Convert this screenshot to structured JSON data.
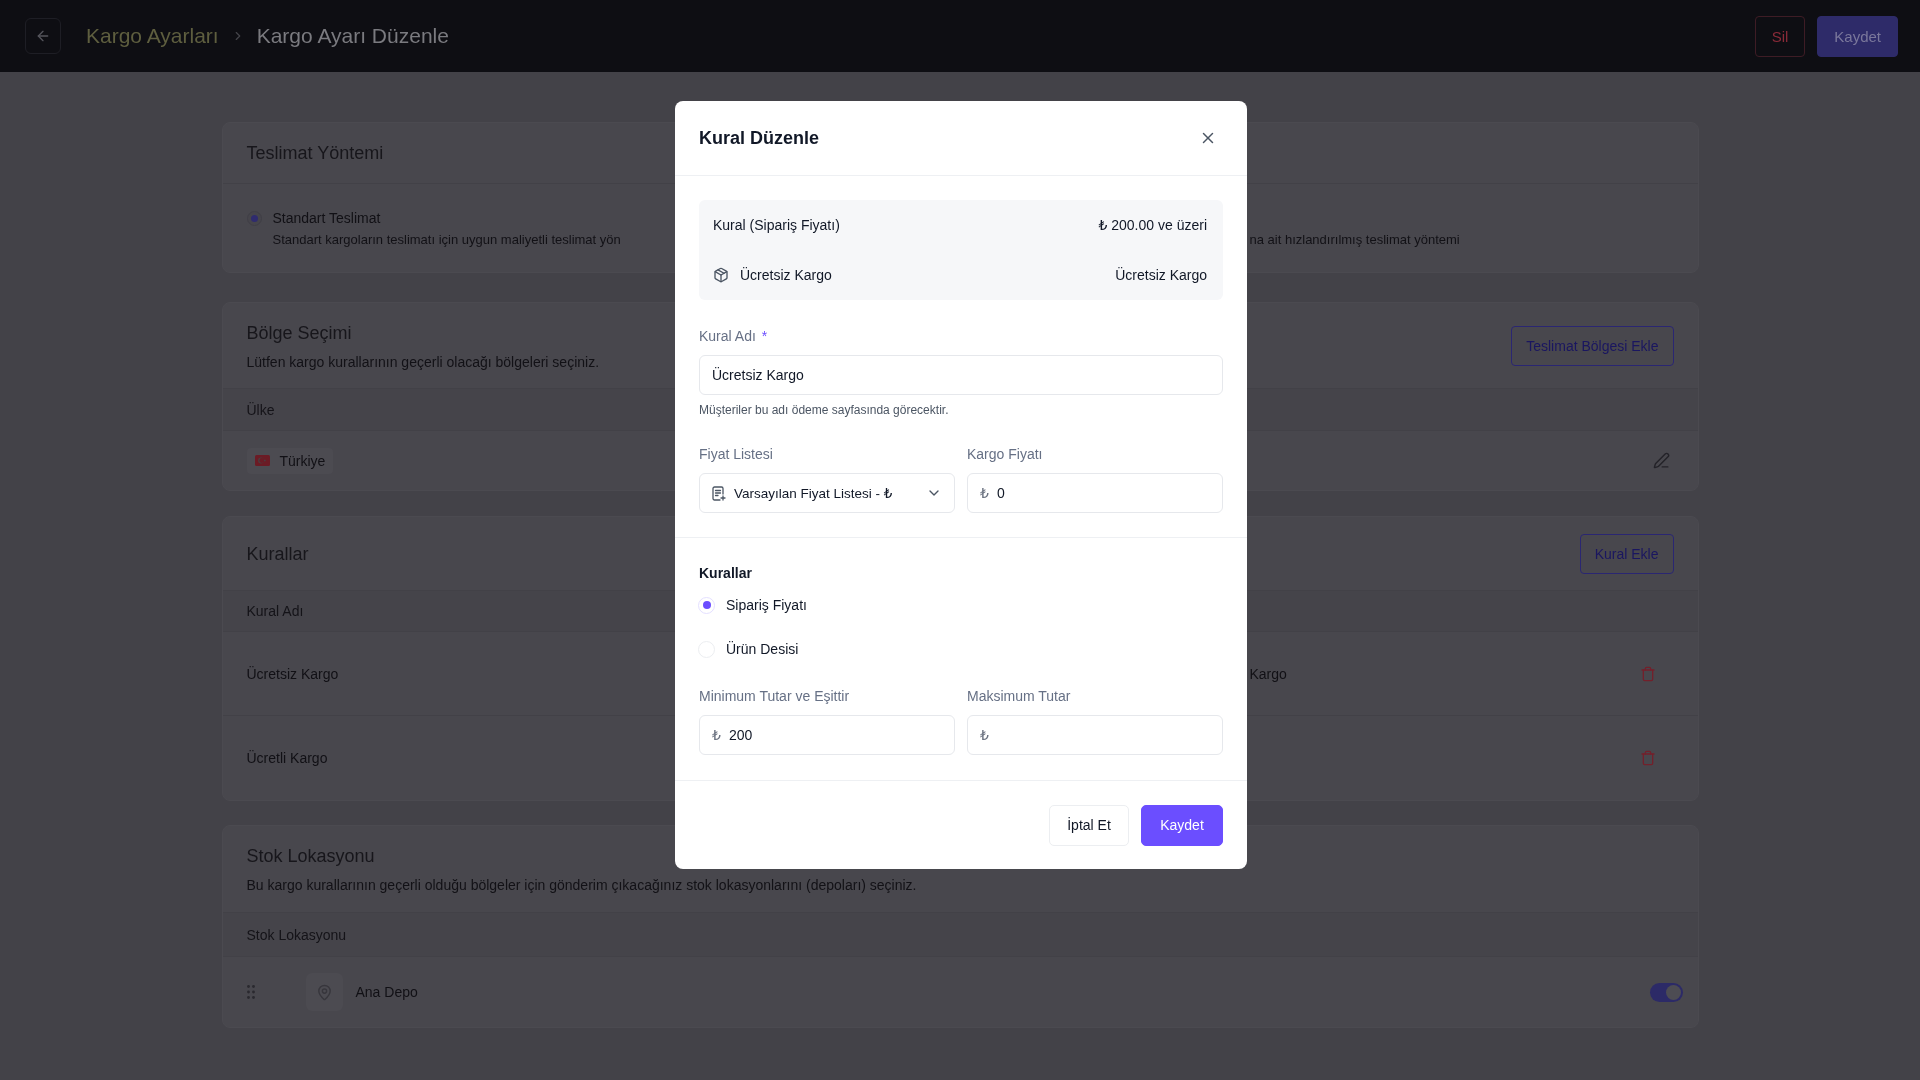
{
  "top_bar": {
    "breadcrumb": [
      {
        "label": "Kargo Ayarları",
        "kind": "link"
      },
      {
        "label": "Kargo Ayarı Düzenle",
        "kind": "current"
      }
    ],
    "buttons": [
      {
        "label": "Sil",
        "kind": "danger"
      },
      {
        "label": "Kaydet",
        "kind": "primary"
      }
    ]
  },
  "delivery_method": {
    "title": "Teslimat Yöntemi",
    "options": [
      {
        "title": "Standart Teslimat",
        "description": "Standart kargoların teslimatı için uygun maliyetli teslimat yön",
        "selected": true
      }
    ],
    "partial_text": "na ait hızlandırılmış teslimat yöntemi"
  },
  "region": {
    "title": "Bölge Seçimi",
    "subtitle": "Lütfen kargo kurallarının geçerli olacağı bölgeleri seçiniz.",
    "button": "Teslimat Bölgesi Ekle",
    "columns": [
      "Ülke"
    ],
    "rows": [
      {
        "country": "Türkiye"
      }
    ]
  },
  "rules": {
    "title": "Kurallar",
    "button": "Kural Ekle",
    "columns": [
      "Kural Adı"
    ],
    "rows": [
      {
        "name": "Ücretsiz Kargo",
        "column_2": "Kargo"
      },
      {
        "name": "Ücretli Kargo"
      }
    ]
  },
  "stock": {
    "title": "Stok Lokasyonu",
    "subtitle": "Bu kargo kurallarının geçerli olduğu bölgeler için gönderim çıkacağınız stok lokasyonlarını (depoları) seçiniz.",
    "columns": [
      "Stok Lokasyonu"
    ],
    "rows": [
      {
        "name": "Ana Depo",
        "on": true
      }
    ]
  },
  "modal": {
    "title": "Kural Düzenle",
    "summary": [
      {
        "kind": "rule",
        "label": "Kural (Sipariş Fiyatı)",
        "value": "₺ 200.00 ve üzeri"
      },
      {
        "kind": "shipping",
        "label": "Ücretsiz Kargo",
        "value": "Ücretsiz Kargo"
      }
    ],
    "name_field": {
      "label": "Kural Adı",
      "required_mark": "*",
      "value": "Ücretsiz Kargo",
      "help": "Müşteriler bu adı ödeme sayfasında görecektir."
    },
    "price_list": {
      "label": "Fiyat Listesi",
      "value": "Varsayılan Fiyat Listesi - ₺"
    },
    "shipping_price": {
      "label": "Kargo Fiyatı",
      "prefix": "₺",
      "value": "0"
    },
    "rule_type": {
      "title": "Kurallar",
      "options": [
        {
          "label": "Sipariş Fiyatı",
          "selected": true
        },
        {
          "label": "Ürün Desisi",
          "selected": false
        }
      ]
    },
    "min_amount": {
      "label": "Minimum Tutar ve Eşittir",
      "prefix": "₺",
      "value": "200"
    },
    "max_amount": {
      "label": "Maksimum Tutar",
      "prefix": "₺"
    },
    "buttons": [
      {
        "label": "İptal Et",
        "kind": "secondary"
      },
      {
        "label": "Kaydet",
        "kind": "primary"
      }
    ]
  }
}
